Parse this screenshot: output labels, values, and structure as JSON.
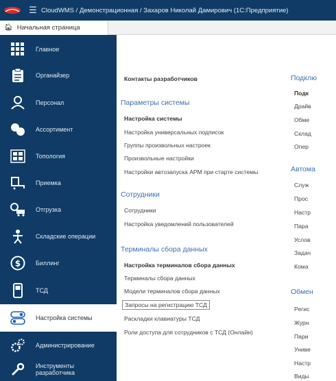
{
  "window": {
    "title": "CloudWMS / Демонстрационная / Захаров Николай Дамирович  (1С:Предприятие)",
    "logo_icon": "1c-logo-icon",
    "menu_icon": "hamburger-icon"
  },
  "tabs": [
    {
      "label": "Начальная страница",
      "icon": "home-icon"
    }
  ],
  "sidebar": {
    "items": [
      {
        "label": "Главное",
        "icon": "grid-icon"
      },
      {
        "label": "Органайзер",
        "icon": "clipboard-icon"
      },
      {
        "label": "Персонал",
        "icon": "people-icon"
      },
      {
        "label": "Ассортимент",
        "icon": "boxes-icon"
      },
      {
        "label": "Топология",
        "icon": "racks-icon"
      },
      {
        "label": "Приемка",
        "icon": "receiving-icon"
      },
      {
        "label": "Отгрузка",
        "icon": "shipping-icon"
      },
      {
        "label": "Складские операции",
        "icon": "worker-icon"
      },
      {
        "label": "Биллинг",
        "icon": "money-icon"
      },
      {
        "label": "ТСД",
        "icon": "scanner-icon"
      },
      {
        "label": "Настройка системы",
        "icon": "settings-toggle-icon",
        "active": true
      },
      {
        "label": "Администрирование",
        "icon": "gears-icon"
      },
      {
        "label": "Инструменты разработчика",
        "icon": "wrench-icon"
      }
    ]
  },
  "col1": {
    "contacts": "Контакты разработчиков",
    "sections": [
      {
        "title": "Параметры системы",
        "items": [
          {
            "label": "Настройка системы",
            "bold": true
          },
          {
            "label": "Настройка универсальных подписок"
          },
          {
            "label": "Группы произвольных настроек"
          },
          {
            "label": "Произвольные настройки"
          },
          {
            "label": "Настройки автозапуска АРМ при старте системы"
          }
        ]
      },
      {
        "title": "Сотрудники",
        "items": [
          {
            "label": "Сотрудники"
          },
          {
            "label": "Настройка уведомлений пользователей"
          }
        ]
      },
      {
        "title": "Терминалы сбора данных",
        "items": [
          {
            "label": "Настройка терминалов сбора данных",
            "bold": true
          },
          {
            "label": "Терминалы сбора данных"
          },
          {
            "label": "Модели терминалов сбора данных"
          },
          {
            "label": "Запросы на регистрацию ТСД",
            "boxed": true
          },
          {
            "label": "Раскладки клавиатуры ТСД"
          },
          {
            "label": "Роли доступа для сотрудников с ТСД (Онлайн)"
          }
        ]
      }
    ]
  },
  "col2": {
    "sections": [
      {
        "title": "Подклю",
        "items": [
          {
            "label": "Подк",
            "bold": true
          },
          {
            "label": "Драйв"
          },
          {
            "label": "Обме"
          },
          {
            "label": "Склад"
          },
          {
            "label": "Опер"
          }
        ]
      },
      {
        "title": "Автома",
        "items": [
          {
            "label": "Служ"
          },
          {
            "label": "Прос"
          },
          {
            "label": "Настр"
          },
          {
            "label": "Пара"
          },
          {
            "label": "Услов"
          },
          {
            "label": "Задач"
          },
          {
            "label": "Кома"
          }
        ]
      },
      {
        "title": "Обмен",
        "items": [
          {
            "label": "Регис"
          },
          {
            "label": "Журн"
          },
          {
            "label": "Пари"
          },
          {
            "label": "Униве"
          },
          {
            "label": "Настр"
          },
          {
            "label": "Виды"
          }
        ]
      }
    ]
  }
}
